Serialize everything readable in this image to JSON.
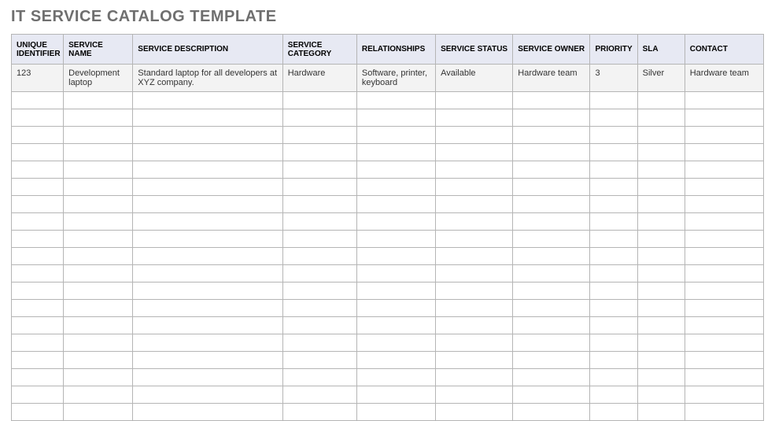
{
  "title": "IT SERVICE CATALOG TEMPLATE",
  "headers": {
    "identifier": "UNIQUE IDENTIFIER",
    "name": "SERVICE NAME",
    "description": "SERVICE DESCRIPTION",
    "category": "SERVICE CATEGORY",
    "relationships": "RELATIONSHIPS",
    "status": "SERVICE STATUS",
    "owner": "SERVICE OWNER",
    "priority": "PRIORITY",
    "sla": "SLA",
    "contact": "CONTACT"
  },
  "rows": [
    {
      "identifier": "123",
      "name": "Development laptop",
      "description": "Standard laptop for all developers at XYZ company.",
      "category": "Hardware",
      "relationships": "Software, printer, keyboard",
      "status": "Available",
      "owner": "Hardware team",
      "priority": "3",
      "sla": "Silver",
      "contact": "Hardware team"
    }
  ],
  "empty_row_count": 19
}
